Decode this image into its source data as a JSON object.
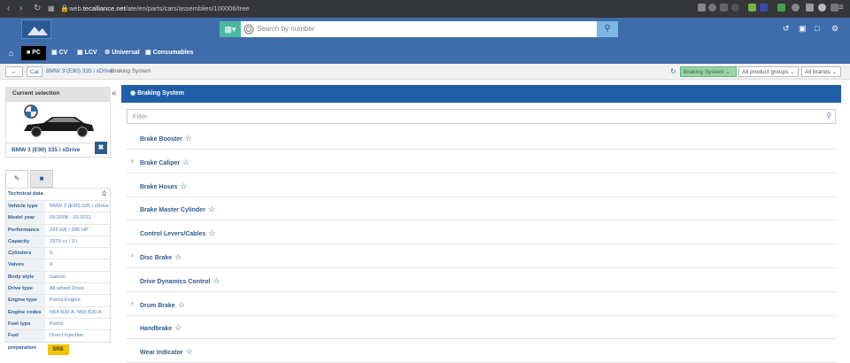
{
  "browser": {
    "url_prefix": "web.",
    "url_domain": "tecalliance.net",
    "url_path": "/ate/en/parts/cars/assemblies/100006/tree"
  },
  "search": {
    "placeholder": "Search by number"
  },
  "nav": {
    "items": [
      {
        "label": "PC"
      },
      {
        "label": "CV"
      },
      {
        "label": "LCV"
      },
      {
        "label": "Universal"
      },
      {
        "label": "Consumables"
      }
    ]
  },
  "breadcrumb": {
    "car": "Car",
    "model": "BMW 3 (E90) 335 i xDrive",
    "current": "Braking System"
  },
  "filters": {
    "assembly": "Braking System",
    "product_groups": "All product groups",
    "brands": "All brands"
  },
  "left": {
    "current_selection": "Current selection",
    "vehicle_name": "BMW 3 (E90) 335 i xDrive",
    "technical_data": "Technical data",
    "rows": [
      {
        "k": "Vehicle type",
        "v": "BMW 3 (E90) 335 i xDrive"
      },
      {
        "k": "Model year",
        "v": "09.2008 - 10.2011"
      },
      {
        "k": "Performance",
        "v": "225 kW / 306 HP"
      },
      {
        "k": "Capacity",
        "v": "2979 cc / 3 l"
      },
      {
        "k": "Cylinders",
        "v": "6"
      },
      {
        "k": "Valves",
        "v": "4"
      },
      {
        "k": "Body style",
        "v": "Saloon"
      },
      {
        "k": "Drive type",
        "v": "All-wheel Drive"
      },
      {
        "k": "Engine type",
        "v": "Petrol Engine"
      },
      {
        "k": "Engine codes",
        "v": "N54 B30 A, N55 B30 A"
      },
      {
        "k": "Fuel type",
        "v": "Petrol"
      },
      {
        "k": "Fuel preparation",
        "v": "Direct Injection"
      }
    ],
    "srs": "SRS"
  },
  "main": {
    "title": "Braking System",
    "filter_placeholder": "Filter",
    "items": [
      {
        "label": "Brake Booster",
        "expandable": false
      },
      {
        "label": "Brake Caliper",
        "expandable": true
      },
      {
        "label": "Brake Hoses",
        "expandable": false
      },
      {
        "label": "Brake Master Cylinder",
        "expandable": false
      },
      {
        "label": "Control Levers/Cables",
        "expandable": false
      },
      {
        "label": "Disc Brake",
        "expandable": true
      },
      {
        "label": "Drive Dynamics Control",
        "expandable": false
      },
      {
        "label": "Drum Brake",
        "expandable": true
      },
      {
        "label": "Handbrake",
        "expandable": false
      },
      {
        "label": "Wear Indicator",
        "expandable": false
      }
    ]
  },
  "colors": {
    "brand_blue": "#3f6dab",
    "header_blue": "#1f5fa8",
    "link_blue": "#2c5c8d",
    "teal": "#4bb8a3",
    "srs_yellow": "#f5c400"
  }
}
